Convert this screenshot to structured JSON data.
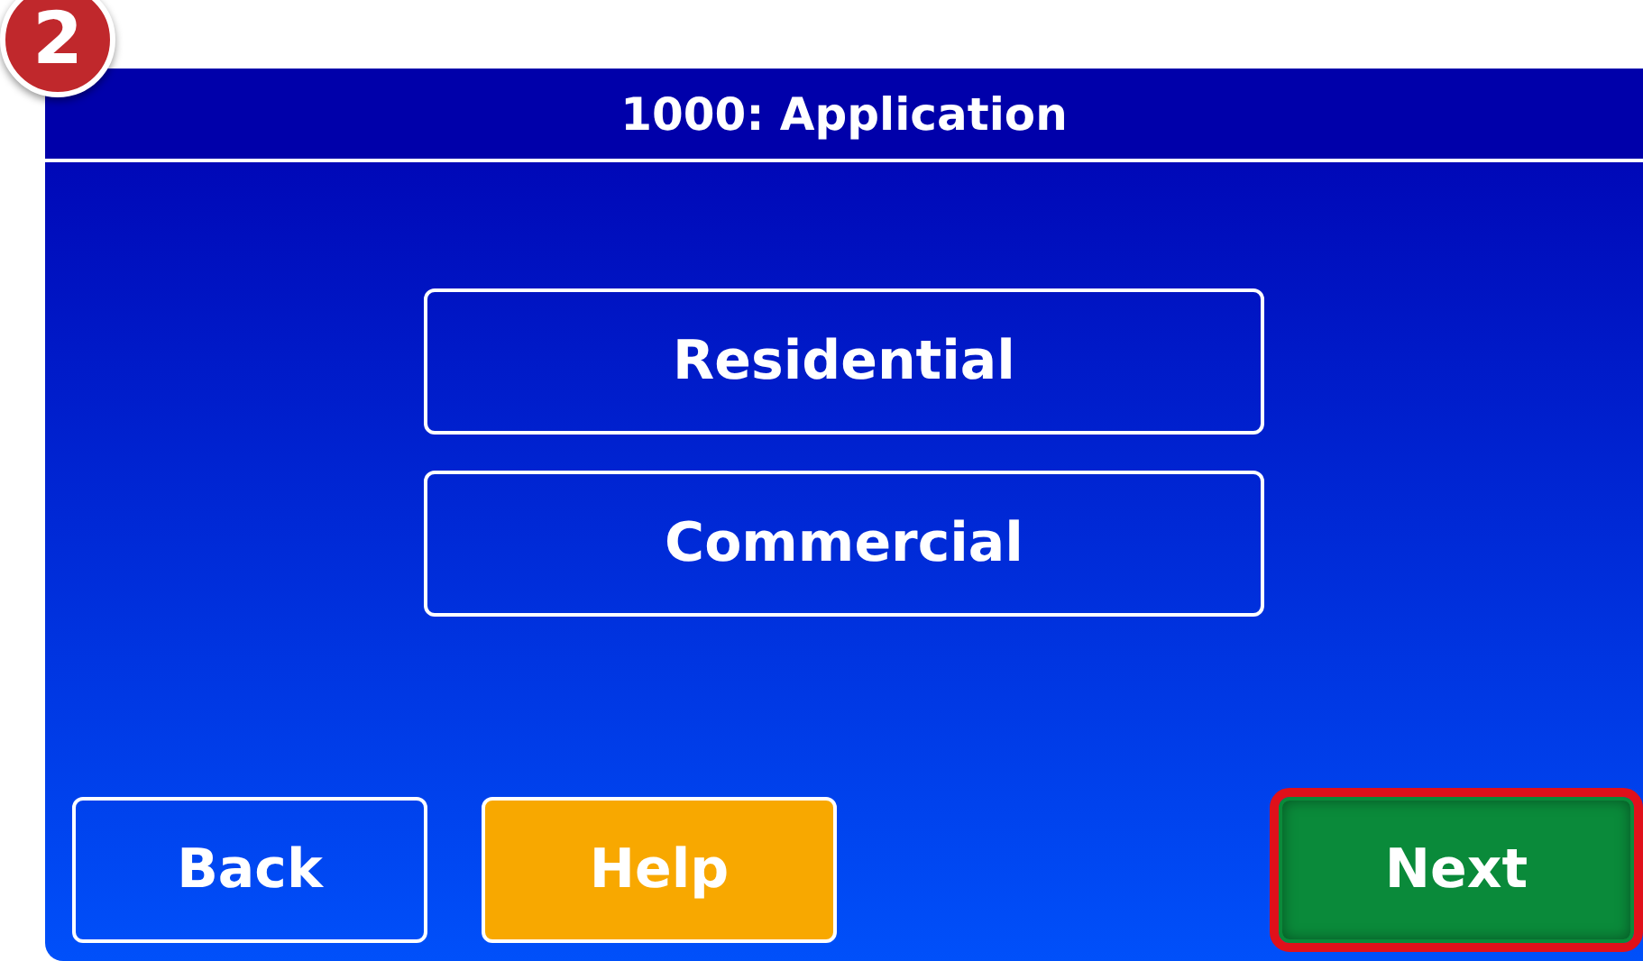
{
  "step_badge": "2",
  "title": "1000: Application",
  "options": [
    {
      "label": "Residential"
    },
    {
      "label": "Commercial"
    }
  ],
  "buttons": [
    {
      "label": "Back",
      "kind": "outline",
      "highlighted": false
    },
    {
      "label": "Help",
      "kind": "help",
      "highlighted": false
    },
    {
      "label": "Next",
      "kind": "next",
      "highlighted": true
    }
  ]
}
